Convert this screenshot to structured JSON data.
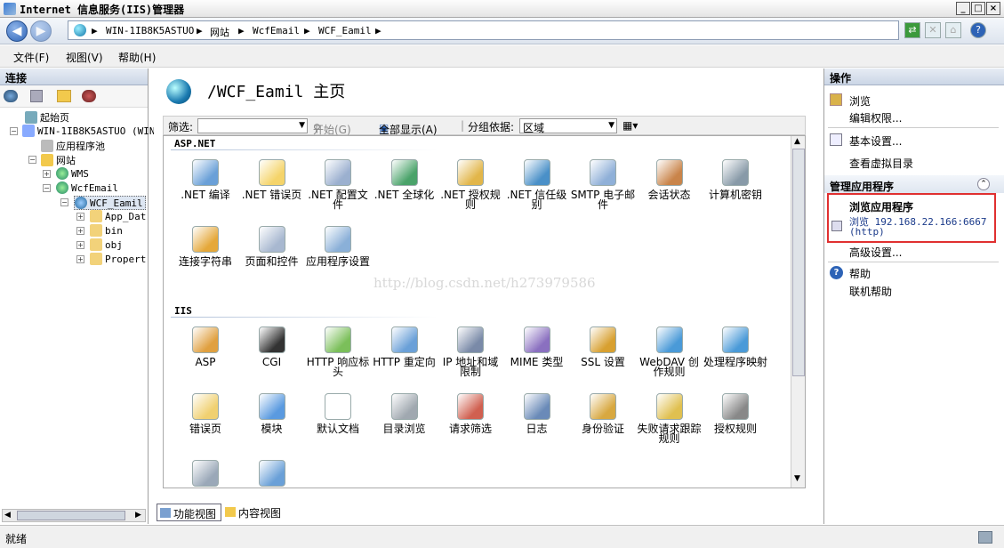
{
  "window": {
    "title": "Internet 信息服务(IIS)管理器"
  },
  "address": {
    "crumbs": [
      "WIN-1IB8K5ASTUO",
      "网站",
      "WcfEmail",
      "WCF_Eamil"
    ]
  },
  "menu": {
    "file": "文件(F)",
    "view": "视图(V)",
    "help": "帮助(H)"
  },
  "connections": {
    "title": "连接",
    "tree": {
      "start": "起始页",
      "server": "WIN-1IB8K5ASTUO (WIN",
      "apppools": "应用程序池",
      "sites": "网站",
      "wms": "WMS",
      "wcfemail": "WcfEmail",
      "wcfeamil": "WCF_Eamil",
      "appdata": "App_Dat",
      "bin": "bin",
      "obj": "obj",
      "properties": "Propert"
    }
  },
  "center": {
    "title": "/WCF_Eamil 主页",
    "filter_label": "筛选:",
    "start_btn": "开始(G)",
    "show_all": "全部显示(A)",
    "group_label": "分组依据:",
    "group_value": "区域",
    "watermark": "http://blog.csdn.net/h273979586",
    "groups": [
      {
        "name": "ASP.NET",
        "features": [
          ".NET 编译",
          ".NET 错误页",
          ".NET 配置文件",
          ".NET 全球化",
          ".NET 授权规则",
          ".NET 信任级别",
          "SMTP 电子邮件",
          "会话状态",
          "计算机密钥",
          "连接字符串",
          "页面和控件",
          "应用程序设置"
        ]
      },
      {
        "name": "IIS",
        "features": [
          "ASP",
          "CGI",
          "HTTP 响应标头",
          "HTTP 重定向",
          "IP 地址和域限制",
          "MIME 类型",
          "SSL 设置",
          "WebDAV 创作规则",
          "处理程序映射",
          "错误页",
          "模块",
          "默认文档",
          "目录浏览",
          "请求筛选",
          "日志",
          "身份验证",
          "失败请求跟踪规则",
          "授权规则",
          "",
          ""
        ]
      }
    ],
    "tabs": {
      "features": "功能视图",
      "content": "内容视图"
    }
  },
  "actions": {
    "title": "操作",
    "browse": "浏览",
    "edit_perm": "编辑权限...",
    "basic": "基本设置...",
    "vdirs": "查看虚拟目录",
    "manage_title": "管理应用程序",
    "browse_app_title": "浏览应用程序",
    "browse_app_link": "浏览 192.168.22.166:6667",
    "browse_app_proto": "(http)",
    "advanced": "高级设置...",
    "help": "帮助",
    "online_help": "联机帮助"
  },
  "status": {
    "text": "就绪"
  },
  "colors": {
    "accent": "#2d63b6",
    "highlight_box": "#e03030",
    "link": "#000000"
  }
}
